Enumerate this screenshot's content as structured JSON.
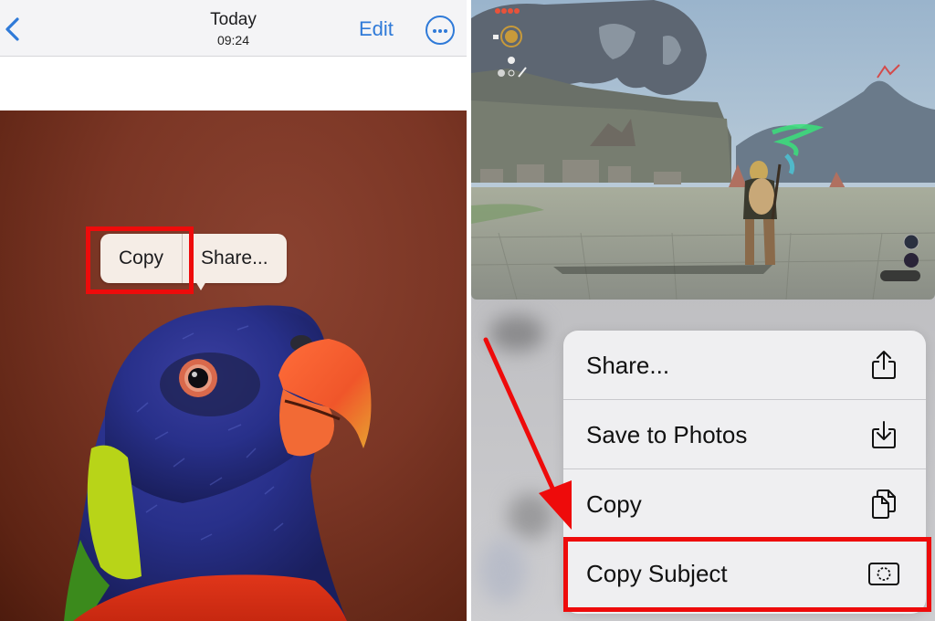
{
  "left_panel": {
    "navbar": {
      "back_icon": "chevron-left-icon",
      "title": "Today",
      "subtitle": "09:24",
      "edit_label": "Edit",
      "more_icon": "ellipsis-circle-icon"
    },
    "photo": {
      "subject": "rainbow lorikeet parrot"
    },
    "callout_menu": {
      "items": [
        {
          "label": "Copy",
          "highlighted": true
        },
        {
          "label": "Share..."
        }
      ]
    }
  },
  "right_panel": {
    "game_screenshot": {
      "subject": "Zelda: Tears of the Kingdom gameplay"
    },
    "context_menu": {
      "items": [
        {
          "label": "Share...",
          "icon": "share-icon"
        },
        {
          "label": "Save to Photos",
          "icon": "save-download-icon"
        },
        {
          "label": "Copy",
          "icon": "copy-documents-icon"
        },
        {
          "label": "Copy Subject",
          "icon": "copy-subject-icon",
          "highlighted": true
        }
      ]
    }
  },
  "colors": {
    "ios_blue": "#2f7ad8",
    "highlight_red": "#ee0b0b",
    "menu_bg": "#efeff1",
    "callout_bg": "#f5ede6"
  }
}
